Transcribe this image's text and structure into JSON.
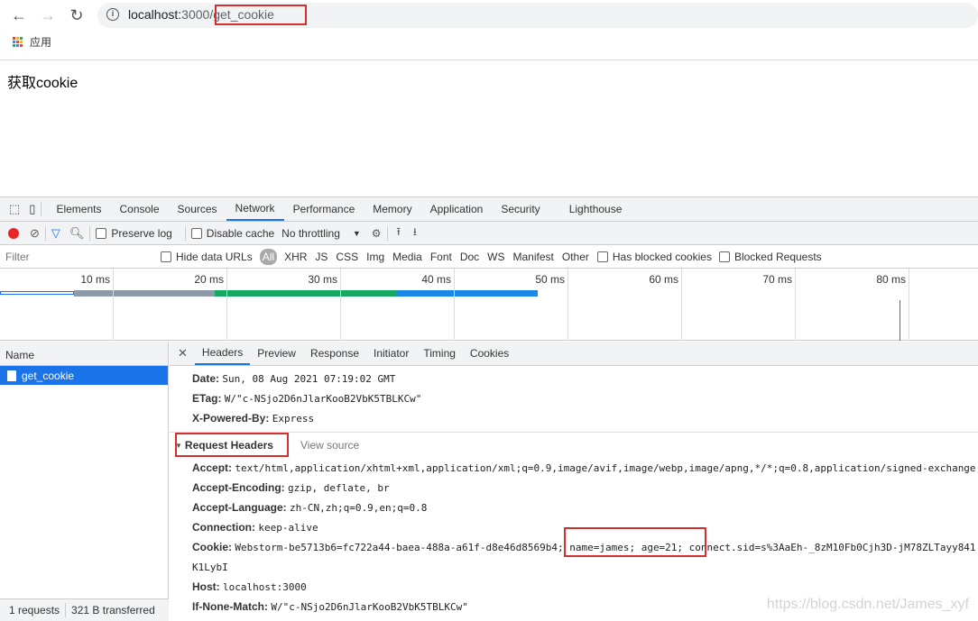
{
  "browser": {
    "url_host": "localhost:",
    "url_port": "3000",
    "url_path": "/get_cookie",
    "bookmarks_label": "应用"
  },
  "page": {
    "text": "获取cookie"
  },
  "devtools": {
    "tabs": [
      "Elements",
      "Console",
      "Sources",
      "Network",
      "Performance",
      "Memory",
      "Application",
      "Security",
      "Lighthouse"
    ],
    "active_tab": "Network",
    "toolbar": {
      "preserve_log": "Preserve log",
      "disable_cache": "Disable cache",
      "throttling": "No throttling"
    },
    "filter": {
      "placeholder": "Filter",
      "hide_data_urls": "Hide data URLs",
      "types": [
        "All",
        "XHR",
        "JS",
        "CSS",
        "Img",
        "Media",
        "Font",
        "Doc",
        "WS",
        "Manifest",
        "Other"
      ],
      "has_blocked": "Has blocked cookies",
      "blocked_requests": "Blocked Requests"
    },
    "timeline": {
      "ticks": [
        "10 ms",
        "20 ms",
        "30 ms",
        "40 ms",
        "50 ms",
        "60 ms",
        "70 ms",
        "80 ms"
      ]
    },
    "requests": {
      "header": "Name",
      "items": [
        "get_cookie"
      ],
      "summary_count": "1 requests",
      "summary_size": "321 B transferred"
    },
    "detail_tabs": [
      "Headers",
      "Preview",
      "Response",
      "Initiator",
      "Timing",
      "Cookies"
    ],
    "response_headers": [
      {
        "k": "Date:",
        "v": "Sun, 08 Aug 2021 07:19:02 GMT"
      },
      {
        "k": "ETag:",
        "v": "W/\"c-NSjo2D6nJlarKooB2VbK5TBLKCw\""
      },
      {
        "k": "X-Powered-By:",
        "v": "Express"
      }
    ],
    "request_headers_title": "Request Headers",
    "view_source": "View source",
    "request_headers": [
      {
        "k": "Accept:",
        "v": "text/html,application/xhtml+xml,application/xml;q=0.9,image/avif,image/webp,image/apng,*/*;q=0.8,application/signed-exchange;"
      },
      {
        "k": "Accept-Encoding:",
        "v": "gzip, deflate, br"
      },
      {
        "k": "Accept-Language:",
        "v": "zh-CN,zh;q=0.9,en;q=0.8"
      },
      {
        "k": "Connection:",
        "v": "keep-alive"
      },
      {
        "k": "Cookie:",
        "v": "Webstorm-be5713b6=fc722a44-baea-488a-a61f-d8e46d8569b4; name=james; age=21; connect.sid=s%3AaEh-_8zM10Fb0Cjh3D-jM78ZLTayy841."
      },
      {
        "k": "",
        "v": "K1LybI"
      },
      {
        "k": "Host:",
        "v": "localhost:3000"
      },
      {
        "k": "If-None-Match:",
        "v": "W/\"c-NSjo2D6nJlarKooB2VbK5TBLKCw\""
      }
    ]
  },
  "watermark": "https://blog.csdn.net/James_xyf",
  "colors": {
    "accent": "#1a73e8",
    "highlight": "#d32f2f",
    "record": "#e8262a"
  }
}
